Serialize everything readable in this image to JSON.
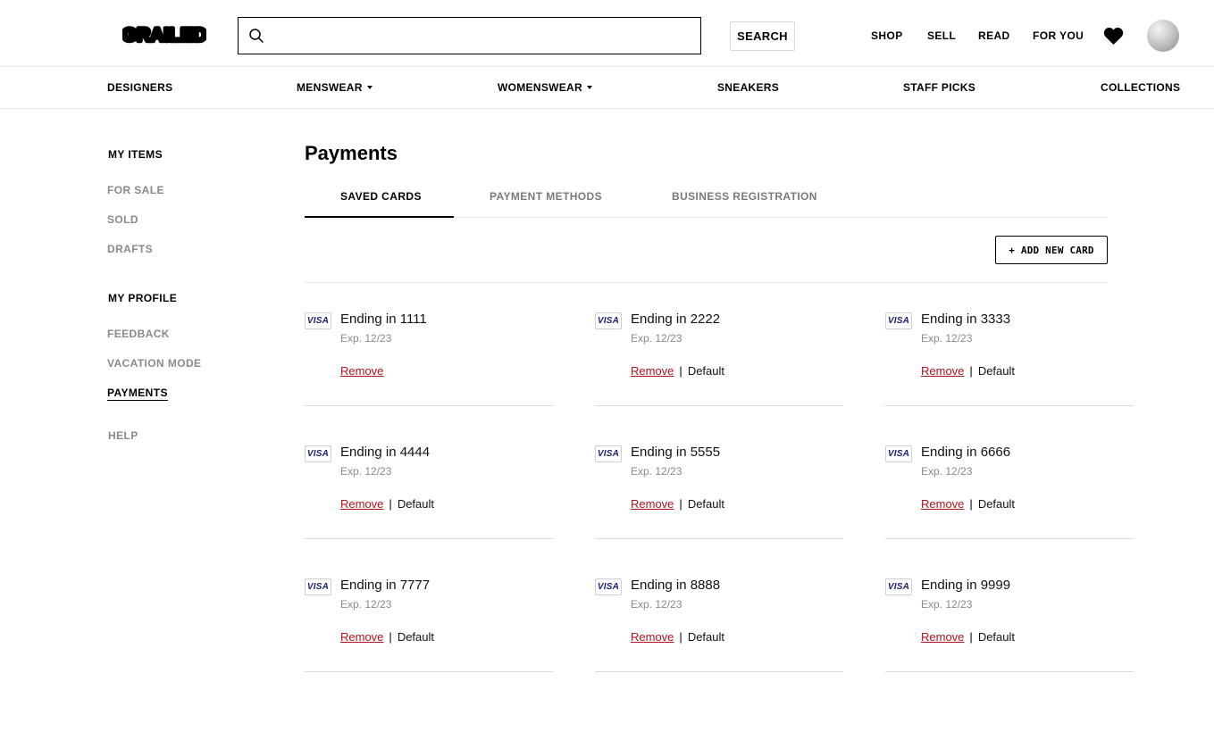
{
  "header": {
    "logo_text": "GRAILED",
    "search": {
      "value": "",
      "placeholder": ""
    },
    "search_button": "SEARCH",
    "nav": [
      "SHOP",
      "SELL",
      "READ",
      "FOR YOU"
    ]
  },
  "categories": [
    "DESIGNERS",
    "MENSWEAR",
    "WOMENSWEAR",
    "SNEAKERS",
    "STAFF PICKS",
    "COLLECTIONS"
  ],
  "sidebar": {
    "my_items_heading": "MY ITEMS",
    "my_items": [
      "FOR SALE",
      "SOLD",
      "DRAFTS"
    ],
    "my_profile_heading": "MY PROFILE",
    "my_profile": [
      "FEEDBACK",
      "VACATION MODE",
      "PAYMENTS"
    ],
    "help": "HELP"
  },
  "main": {
    "title": "Payments",
    "tabs": [
      "SAVED CARDS",
      "PAYMENT METHODS",
      "BUSINESS REGISTRATION"
    ],
    "active_tab": "SAVED CARDS",
    "add_card_label": "+ ADD NEW CARD",
    "cards": [
      {
        "brand": "VISA",
        "title": "Ending in 1111",
        "exp": "Exp. 12/23",
        "remove": "Remove",
        "default": ""
      },
      {
        "brand": "VISA",
        "title": "Ending in 2222",
        "exp": "Exp. 12/23",
        "remove": "Remove",
        "default": "Default"
      },
      {
        "brand": "VISA",
        "title": "Ending in 3333",
        "exp": "Exp. 12/23",
        "remove": "Remove",
        "default": "Default"
      },
      {
        "brand": "VISA",
        "title": "Ending in 4444",
        "exp": "Exp. 12/23",
        "remove": "Remove",
        "default": "Default"
      },
      {
        "brand": "VISA",
        "title": "Ending in 5555",
        "exp": "Exp. 12/23",
        "remove": "Remove",
        "default": "Default"
      },
      {
        "brand": "VISA",
        "title": "Ending in 6666",
        "exp": "Exp. 12/23",
        "remove": "Remove",
        "default": "Default"
      },
      {
        "brand": "VISA",
        "title": "Ending in 7777",
        "exp": "Exp. 12/23",
        "remove": "Remove",
        "default": "Default"
      },
      {
        "brand": "VISA",
        "title": "Ending in 8888",
        "exp": "Exp. 12/23",
        "remove": "Remove",
        "default": "Default"
      },
      {
        "brand": "VISA",
        "title": "Ending in 9999",
        "exp": "Exp. 12/23",
        "remove": "Remove",
        "default": "Default"
      }
    ]
  },
  "colors": {
    "remove_link": "#b0131d",
    "visa_blue": "#1a1f71",
    "muted_text": "#8a8a8a"
  }
}
